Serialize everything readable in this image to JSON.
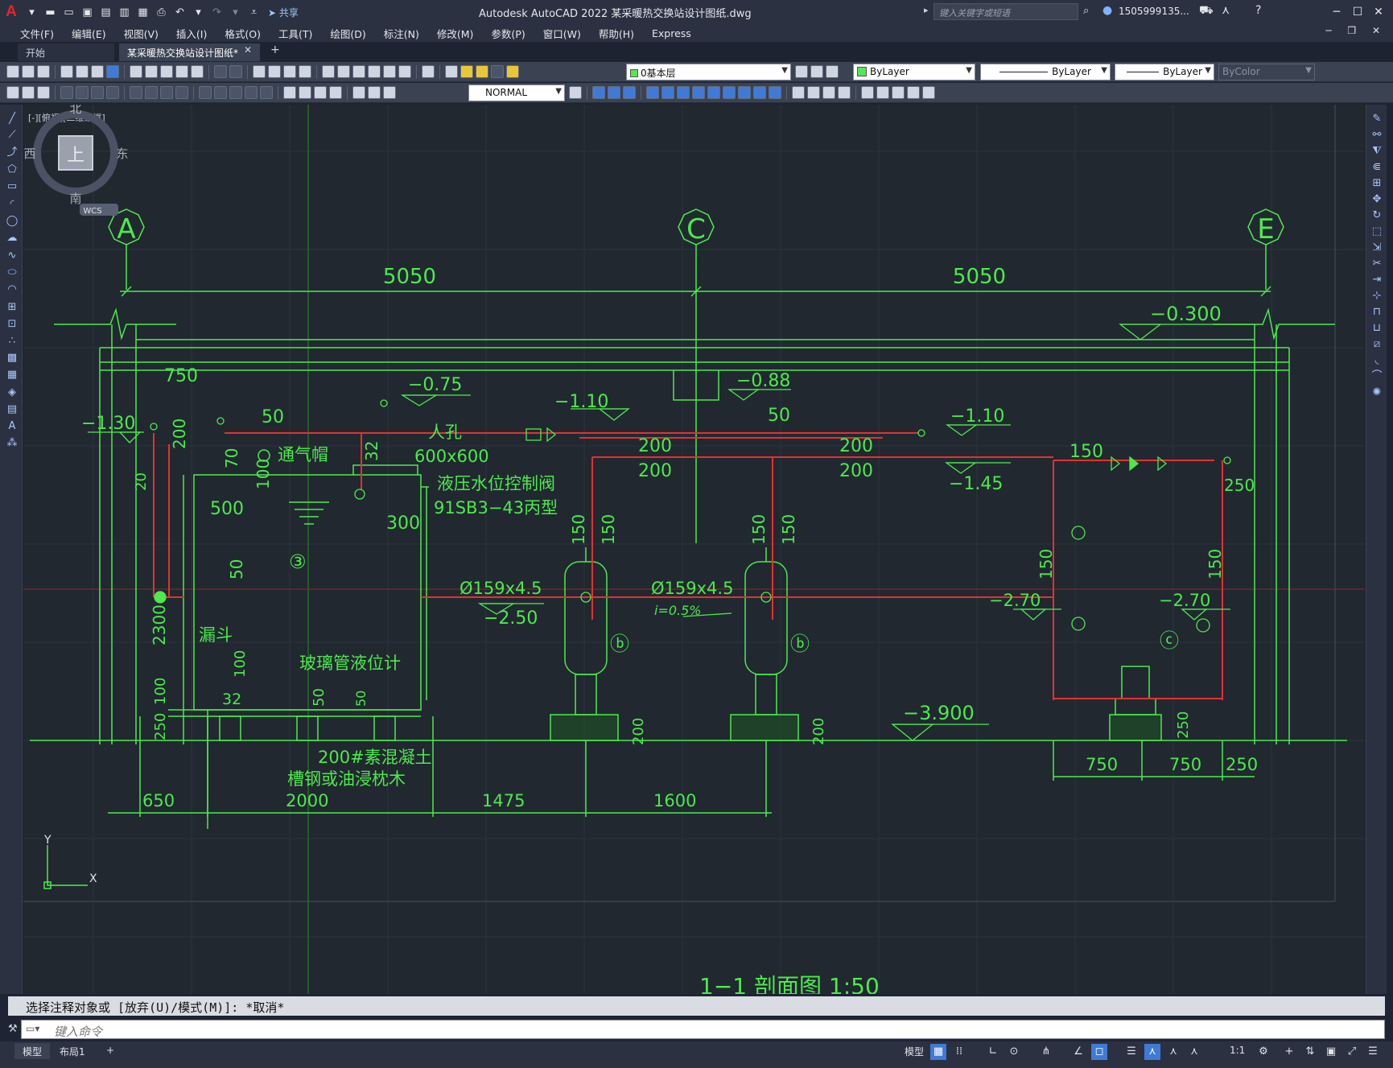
{
  "titlebar": {
    "app_logo": "A",
    "share_label": "共享",
    "window_title": "Autodesk AutoCAD 2022    某采暖热交换站设计图纸.dwg",
    "search_placeholder": "键入关键字或短语",
    "user_name": "1505999135...",
    "icons": [
      "new-icon",
      "open-icon",
      "save-icon",
      "saveas-icon",
      "plot-icon",
      "undo-icon",
      "redo-icon",
      "share-icon",
      "search-icon",
      "user-icon",
      "cart-icon",
      "a360-icon",
      "help-icon"
    ]
  },
  "menubar": {
    "items": [
      "文件(F)",
      "编辑(E)",
      "视图(V)",
      "插入(I)",
      "格式(O)",
      "工具(T)",
      "绘图(D)",
      "标注(N)",
      "修改(M)",
      "参数(P)",
      "窗口(W)",
      "帮助(H)",
      "Express"
    ]
  },
  "tabs": {
    "start": "开始",
    "drawing": "某采暖热交换站设计图纸*"
  },
  "toolbar": {
    "layer": "0基本层",
    "color": "ByLayer",
    "linetype": "ByLayer",
    "lineweight": "ByLayer",
    "plotstyle": "ByColor",
    "dimstyle": "NORMAL"
  },
  "viewport": {
    "label": "[-][俯视][二维线框]"
  },
  "viewcube": {
    "north": "北",
    "south": "南",
    "east": "东",
    "west": "西",
    "face": "上",
    "wcs": "WCS"
  },
  "drawing": {
    "grid_A": "A",
    "grid_C": "C",
    "grid_E": "E",
    "dim_5050_left": "5050",
    "dim_5050_right": "5050",
    "elev_m0300": "−0.300",
    "dim_750_top": "750",
    "elev_m130": "−1.30",
    "elev_m075": "−0.75",
    "elev_m110a": "−1.10",
    "elev_m088": "−0.88",
    "elev_m110b": "−1.10",
    "elev_m145": "−1.45",
    "dim_50a": "50",
    "dim_50b": "50",
    "dim_200a": "200",
    "dim_200b": "200",
    "dim_200c": "200",
    "dim_200d": "200",
    "dim_150_top": "150",
    "dim_200_v": "200",
    "dim_70": "70",
    "dim_32a": "32",
    "vent_cap": "通气帽",
    "manhole": "人孔",
    "manhole_size": "600x600",
    "valve_label": "液压水位控制阀",
    "valve_model": "91SB3−43丙型",
    "dim_20": "20",
    "dim_100a": "100",
    "dim_500": "500",
    "dim_300": "300",
    "tank_no": "③",
    "dim_50v": "50",
    "pipe_159a": "Ø159x4.5",
    "elev_m250": "−2.50",
    "pipe_159b": "Ø159x4.5",
    "slope": "i=0.5%",
    "dim_150_v1": "150",
    "dim_150_v2": "150",
    "dim_150_v3": "150",
    "dim_150_v4": "150",
    "vessel_b1": "ⓑ",
    "vessel_b2": "ⓑ",
    "pump_c": "ⓒ",
    "dim_250_r": "250",
    "dim_150_r1": "150",
    "dim_150_r2": "150",
    "elev_m270a": "−2.70",
    "elev_m270b": "−2.70",
    "funnel": "漏斗",
    "level_gauge": "玻璃管液位计",
    "dim_2300": "2300",
    "dim_100b": "100",
    "dim_100c": "100",
    "dim_250_l": "250",
    "dim_32b": "32",
    "dim_50c": "50",
    "dim_50d": "50",
    "concrete": "200#素混凝土",
    "sleeper": "槽钢或油浸枕木",
    "dim_200_b1": "200",
    "dim_200_b2": "200",
    "elev_m3900": "−3.900",
    "dim_250_p": "250",
    "dim_650": "650",
    "dim_2000": "2000",
    "dim_1475": "1475",
    "dim_1600": "1600",
    "dim_750a": "750",
    "dim_750b": "750",
    "dim_250_bottom": "250",
    "ucs_x": "X",
    "ucs_y": "Y",
    "section_title": "1−1 剖面图 1:50"
  },
  "command": {
    "history": "选择注释对象或 [放弃(U)/模式(M)]: *取消*",
    "input_placeholder": "键入命令"
  },
  "statusbar": {
    "model_tab": "模型",
    "layout_tab": "布局1",
    "add_tab": "+",
    "model_button": "模型",
    "scale": "1:1"
  },
  "colors": {
    "cad_line_green": "#4cea4c",
    "cad_line_red": "#e53030",
    "cad_bg": "#212830",
    "ui_dark": "#2b3140",
    "ui_toolbar": "#3b4252"
  }
}
